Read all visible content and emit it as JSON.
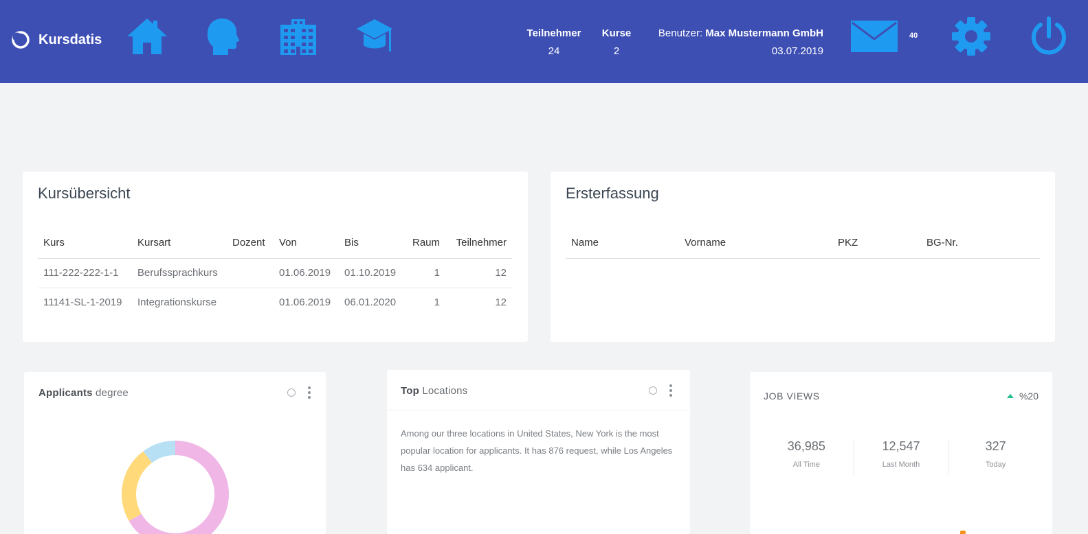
{
  "header": {
    "brand": "Kursdatis",
    "stats": [
      {
        "label": "Teilnehmer",
        "value": "24"
      },
      {
        "label": "Kurse",
        "value": "2"
      }
    ],
    "user_prefix": "Benutzer:",
    "user_name": "Max Mustermann GmbH",
    "date": "03.07.2019",
    "mail_count": "40",
    "accent_icon_color": "#1e9bf0",
    "background_color": "#3e4fb4"
  },
  "kursuebersicht": {
    "title": "Kursübersicht",
    "columns": [
      "Kurs",
      "Kursart",
      "Dozent",
      "Von",
      "Bis",
      "Raum",
      "Teilnehmer"
    ],
    "rows": [
      [
        "111-222-222-1-1",
        "Berufssprachkurs",
        "",
        "01.06.2019",
        "01.10.2019",
        "1",
        "12"
      ],
      [
        "11141-SL-1-2019",
        "Integrationskurse",
        "",
        "01.06.2019",
        "06.01.2020",
        "1",
        "12"
      ]
    ]
  },
  "ersterfassung": {
    "title": "Ersterfassung",
    "columns": [
      "Name",
      "Vorname",
      "PKZ",
      "BG-Nr."
    ]
  },
  "applicants": {
    "title_bold": "Applicants",
    "title_rest": " degree",
    "colors": [
      "#f0b6e6",
      "#ffd97a",
      "#b7e0f5"
    ]
  },
  "top_locations": {
    "title_bold": "Top",
    "title_rest": " Locations",
    "text": "Among our three locations in United States, New York is the most popular location for applicants. It has 876 request, while Los Angeles has 634 applicant."
  },
  "job_views": {
    "title": "JOB VIEWS",
    "trend": "%20",
    "trend_color": "#1fbf8f",
    "stats": [
      {
        "value": "36,985",
        "label": "All Time"
      },
      {
        "value": "12,547",
        "label": "Last Month"
      },
      {
        "value": "327",
        "label": "Today"
      }
    ]
  }
}
